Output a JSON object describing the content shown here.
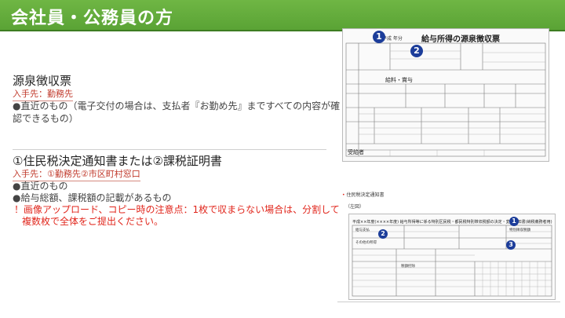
{
  "header": {
    "title": "会社員・公務員の方"
  },
  "section1": {
    "title": "源泉徴収票",
    "source": "入手先：勤務先",
    "bullet_line1": "●直近のもの（電子交付の場合は、支払者『お勤め先』まですべての内容が確",
    "bullet_line2": "認できるもの）"
  },
  "section2": {
    "title": "①住民税決定通知書または②課税証明書",
    "source": "入手先：①勤務先②市区町村窓口",
    "bullet1": "●直近のもの",
    "bullet2": "●給与総額、課税額の記載があるもの",
    "warning_line1": "！画像アップロード、コピー時の注意点：1枚で収まらない場合は、分割して",
    "warning_line2": "複数枚で全体をご提出ください。"
  },
  "form1": {
    "nendo": "平成 年分",
    "title": "給与所得の源泉徴収票",
    "label_kyuyo": "給料・賞与",
    "label_bottom": "受給者",
    "badge1": "1",
    "badge2": "2"
  },
  "form2": {
    "caption": "住民税決定通知書",
    "caption_dot": "•",
    "sample_label": "（左図）",
    "title": "平成××年度(××××年度) 給与所得等に係る特別区民税・都民税特別徴収税額の決定・変更通知書(納税義務者用)",
    "cell_a": "給与支払",
    "cell_b": "その他の所得",
    "cell_c": "税額控除",
    "cell_d": "特別徴収税額",
    "badge1": "1",
    "badge2": "2",
    "badge3": "3"
  },
  "colors": {
    "header": "#5aa335",
    "source_red": "#c0392b",
    "warning_red": "#e1261c",
    "badge_blue": "#1c3d9a"
  }
}
